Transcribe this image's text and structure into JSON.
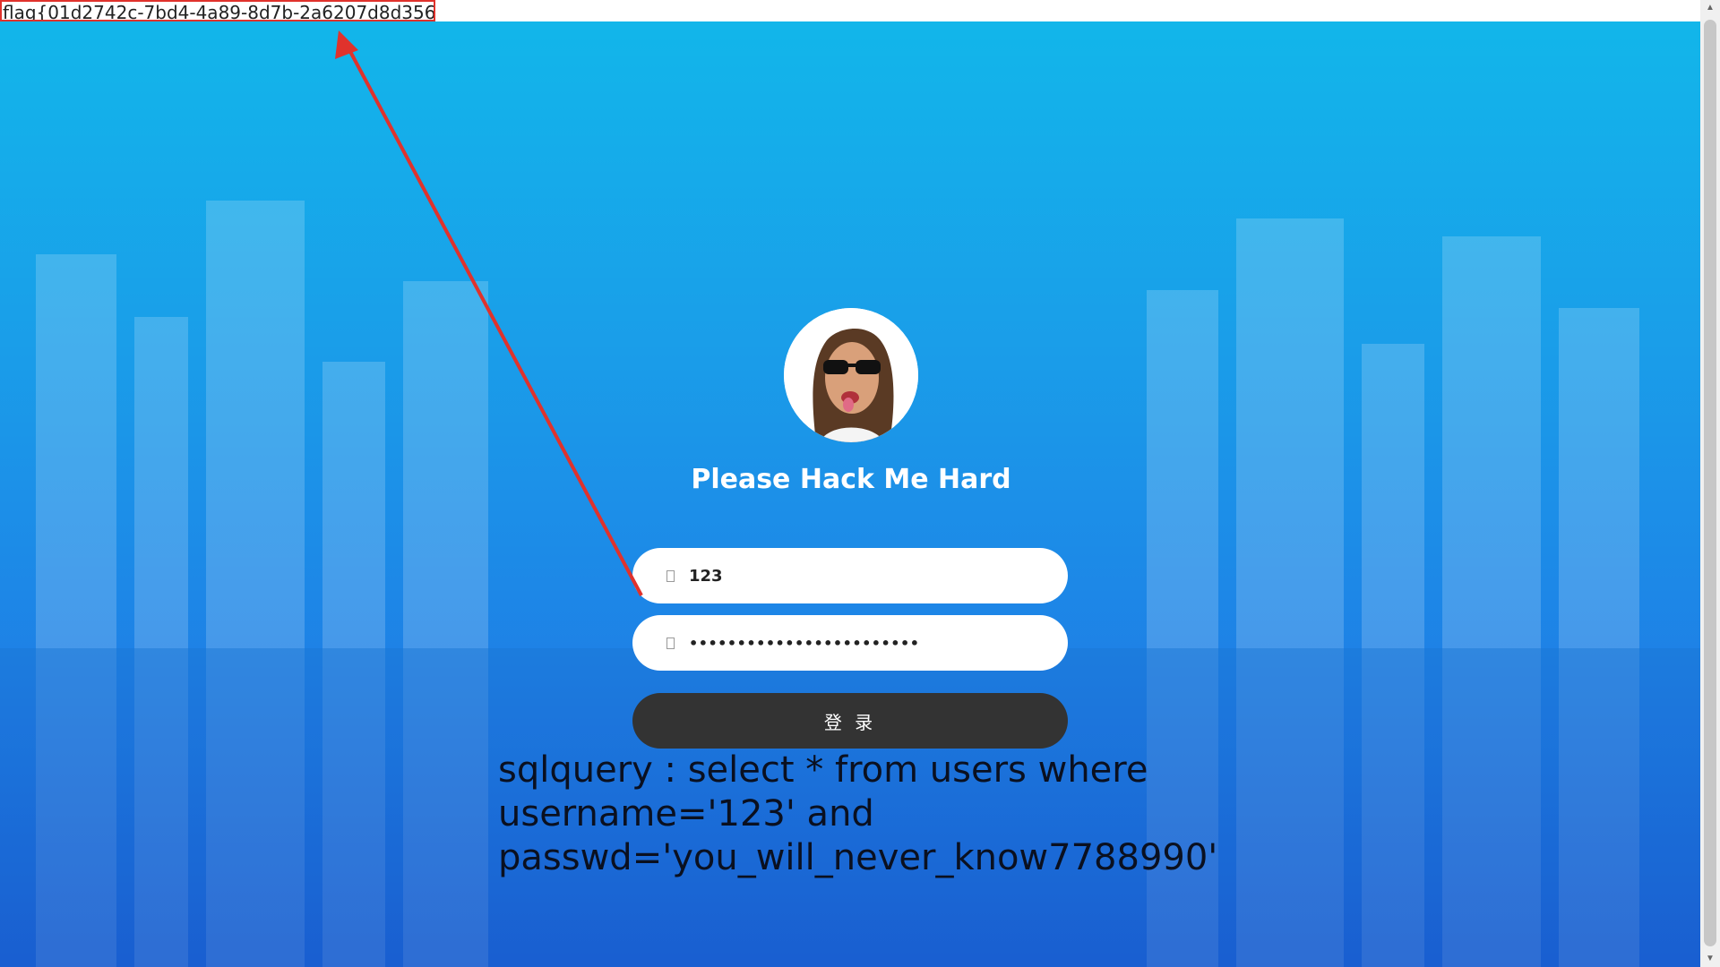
{
  "flag_text": "flag{01d2742c-7bd4-4a89-8d7b-2a6207d8d356}",
  "login": {
    "title": "Please Hack Me Hard",
    "username_value": "123",
    "password_mask": "••••••••••••••••••••••••",
    "button_label": "登 录"
  },
  "sql_output": {
    "line1": "sqlquery : select * from users where",
    "line2": "username='123' and",
    "line3": "passwd='you_will_never_know7788990'"
  },
  "icons": {
    "user_field": "user-icon",
    "password_field": "lock-icon",
    "scroll_up": "chevron-up-icon",
    "scroll_down": "chevron-down-icon"
  },
  "colors": {
    "background_top": "#12b6ea",
    "background_bottom": "#1b62d8",
    "button": "#333333",
    "annotation": "#e0322c"
  }
}
